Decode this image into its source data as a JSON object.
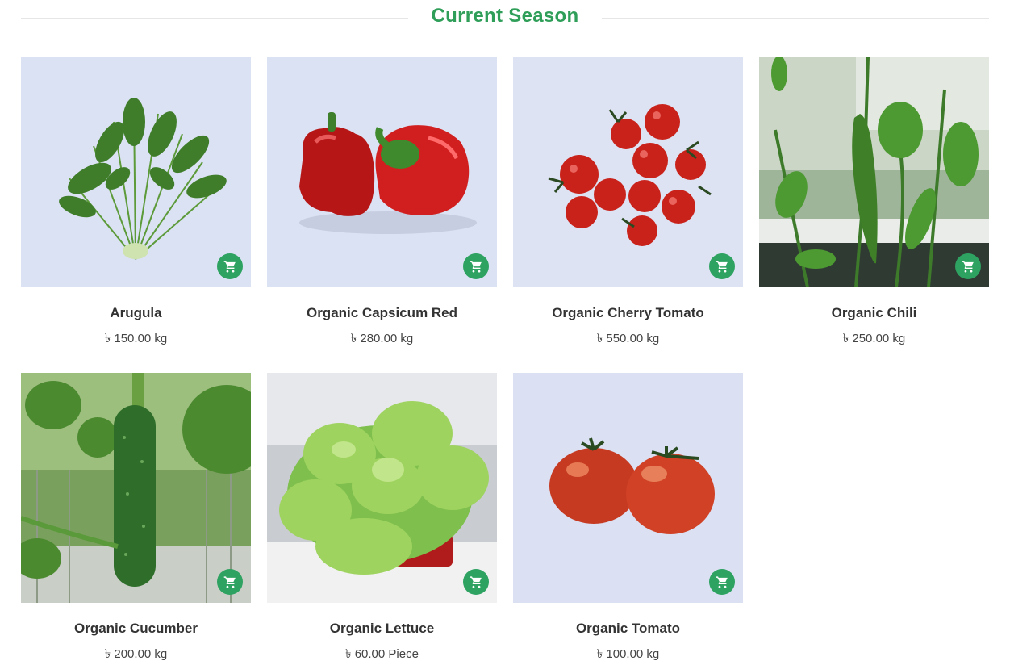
{
  "section": {
    "title": "Current Season"
  },
  "colors": {
    "accent": "#2e9e58",
    "cart_button": "#2ea261"
  },
  "currency_symbol": "৳",
  "products": [
    {
      "name": "Arugula",
      "price": "৳ 150.00 kg",
      "image": "arugula"
    },
    {
      "name": "Organic Capsicum Red",
      "price": "৳ 280.00 kg",
      "image": "red-capsicum"
    },
    {
      "name": "Organic Cherry Tomato",
      "price": "৳ 550.00 kg",
      "image": "cherry-tomato"
    },
    {
      "name": "Organic Chili",
      "price": "৳ 250.00 kg",
      "image": "chili-plant"
    },
    {
      "name": "Organic Cucumber",
      "price": "৳ 200.00 kg",
      "image": "cucumber-plant"
    },
    {
      "name": "Organic Lettuce",
      "price": "৳ 60.00 Piece",
      "image": "lettuce"
    },
    {
      "name": "Organic Tomato",
      "price": "৳ 100.00 kg",
      "image": "tomato"
    }
  ],
  "icons": {
    "cart": "shopping-cart-icon"
  }
}
